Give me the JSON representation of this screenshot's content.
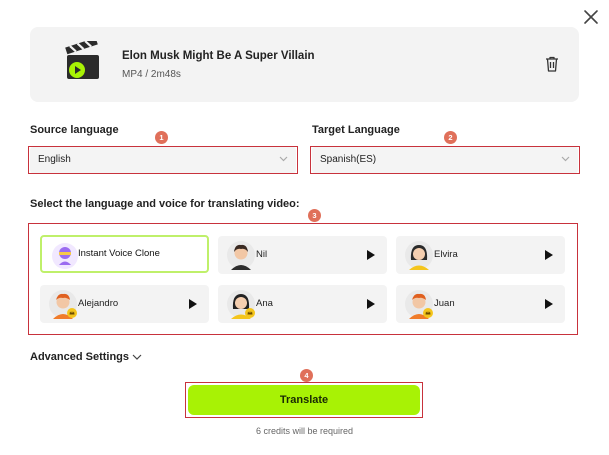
{
  "file": {
    "title": "Elon Musk Might Be A Super Villain",
    "meta": "MP4 / 2m48s"
  },
  "source": {
    "label": "Source language",
    "value": "English"
  },
  "target": {
    "label": "Target Language",
    "value": "Spanish(ES)"
  },
  "voice_section": {
    "label": "Select the language and voice for translating video:"
  },
  "voices": [
    {
      "name": "Instant Voice Clone",
      "selected": true,
      "premium": false
    },
    {
      "name": "Nil",
      "selected": false,
      "premium": false
    },
    {
      "name": "Elvira",
      "selected": false,
      "premium": false
    },
    {
      "name": "Alejandro",
      "selected": false,
      "premium": true
    },
    {
      "name": "Ana",
      "selected": false,
      "premium": true
    },
    {
      "name": "Juan",
      "selected": false,
      "premium": true
    }
  ],
  "badges": [
    "1",
    "2",
    "3",
    "4"
  ],
  "advanced": {
    "label": "Advanced Settings"
  },
  "translate": {
    "label": "Translate",
    "credits": "6 credits will be required"
  },
  "colors": {
    "accent": "#a8f205",
    "selected_border": "#bff06a",
    "annotation_red": "#c8323c",
    "badge": "#e0705a"
  },
  "icons": {
    "close": "close-icon",
    "file": "clapperboard-icon",
    "trash": "trash-icon",
    "chevron": "chevron-down-icon",
    "play": "play-icon"
  }
}
